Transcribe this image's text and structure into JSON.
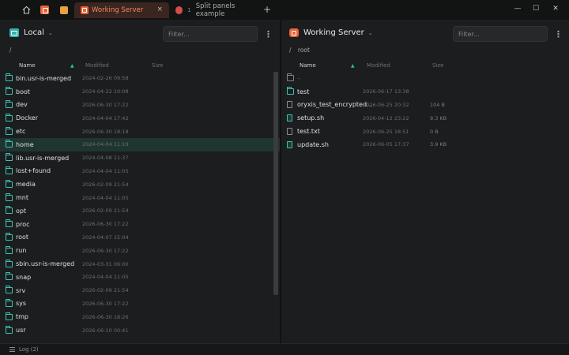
{
  "tabs": {
    "active": {
      "label": "Working Server",
      "close": "×"
    },
    "second": {
      "number": "1",
      "label": "Split panels example"
    },
    "new_tab": "+"
  },
  "window": {
    "minimize": "—",
    "maximize": "☐",
    "close": "✕"
  },
  "left": {
    "location": "Local",
    "filter_placeholder": "Filter...",
    "path": "/",
    "columns": {
      "name": "Name",
      "modified": "Modified",
      "size": "Size"
    },
    "rows": [
      {
        "name": "bin.usr-is-merged",
        "modified": "2024-02-26 09:58",
        "size": ""
      },
      {
        "name": "boot",
        "modified": "2024-04-22 10:08",
        "size": ""
      },
      {
        "name": "dev",
        "modified": "2026-06-30 17:22",
        "size": ""
      },
      {
        "name": "Docker",
        "modified": "2024-04-04 17:42",
        "size": ""
      },
      {
        "name": "etc",
        "modified": "2026-06-30 18:18",
        "size": ""
      },
      {
        "name": "home",
        "modified": "2024-04-04 11:19",
        "size": ""
      },
      {
        "name": "lib.usr-is-merged",
        "modified": "2024-04-08 11:37",
        "size": ""
      },
      {
        "name": "lost+found",
        "modified": "2024-04-04 11:05",
        "size": ""
      },
      {
        "name": "media",
        "modified": "2026-02-09 21:54",
        "size": ""
      },
      {
        "name": "mnt",
        "modified": "2024-04-04 11:05",
        "size": ""
      },
      {
        "name": "opt",
        "modified": "2026-02-09 21:54",
        "size": ""
      },
      {
        "name": "proc",
        "modified": "2026-06-30 17:22",
        "size": ""
      },
      {
        "name": "root",
        "modified": "2024-04-07 15:04",
        "size": ""
      },
      {
        "name": "run",
        "modified": "2026-06-30 17:22",
        "size": ""
      },
      {
        "name": "sbin.usr-is-merged",
        "modified": "2024-03-31 06:00",
        "size": ""
      },
      {
        "name": "snap",
        "modified": "2024-04-04 11:05",
        "size": ""
      },
      {
        "name": "srv",
        "modified": "2026-02-09 21:54",
        "size": ""
      },
      {
        "name": "sys",
        "modified": "2026-06-30 17:22",
        "size": ""
      },
      {
        "name": "tmp",
        "modified": "2026-06-30 18:26",
        "size": ""
      },
      {
        "name": "usr",
        "modified": "2026-06-10 00:41",
        "size": ""
      }
    ],
    "selected": "home"
  },
  "right": {
    "location": "Working Server",
    "filter_placeholder": "Filter...",
    "path_sep": "/",
    "path": "root",
    "columns": {
      "name": "Name",
      "modified": "Modified",
      "size": "Size"
    },
    "rows": [
      {
        "name": "..",
        "modified": "",
        "size": "",
        "kind": "up"
      },
      {
        "name": "test",
        "modified": "2026-06-17 13:38",
        "size": "",
        "kind": "folder"
      },
      {
        "name": "oryxis_test_encrypted...",
        "modified": "2026-06-25 20:32",
        "size": "104 B",
        "kind": "file"
      },
      {
        "name": "setup.sh",
        "modified": "2026-04-12 23:22",
        "size": "9.3 KB",
        "kind": "script"
      },
      {
        "name": "test.txt",
        "modified": "2026-06-25 18:51",
        "size": "0 B",
        "kind": "file"
      },
      {
        "name": "update.sh",
        "modified": "2026-06-05 17:37",
        "size": "3.9 KB",
        "kind": "script"
      }
    ]
  },
  "statusbar": {
    "log": "Log (2)"
  },
  "colors": {
    "accent": "#3fc2b6",
    "brand": "#e8643a",
    "selected_row": "#1f3531"
  }
}
